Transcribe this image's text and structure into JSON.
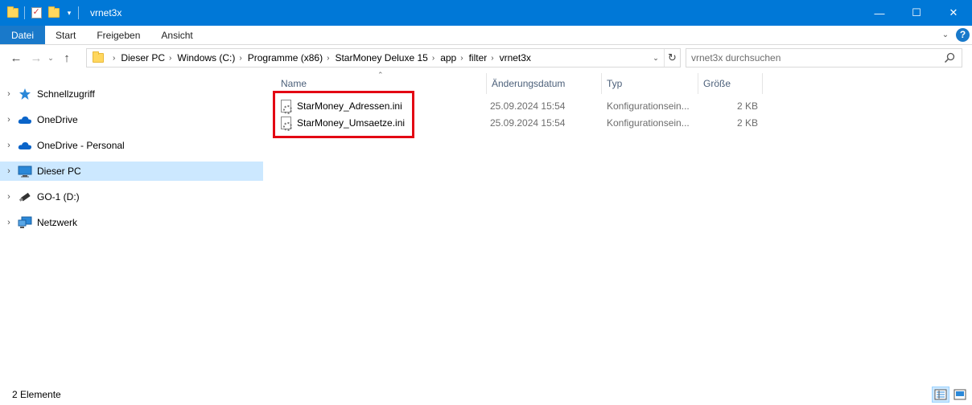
{
  "window": {
    "title": "vrnet3x",
    "minimize_glyph": "—",
    "maximize_glyph": "☐",
    "close_glyph": "✕"
  },
  "ribbon": {
    "tabs": [
      "Datei",
      "Start",
      "Freigeben",
      "Ansicht"
    ],
    "help_label": "?"
  },
  "address": {
    "breadcrumbs": [
      "Dieser PC",
      "Windows (C:)",
      "Programme (x86)",
      "StarMoney Deluxe 15",
      "app",
      "filter",
      "vrnet3x"
    ]
  },
  "search": {
    "placeholder": "vrnet3x durchsuchen"
  },
  "navigation": {
    "items": [
      {
        "label": "Schnellzugriff",
        "icon": "quick-access-star-icon"
      },
      {
        "label": "OneDrive",
        "icon": "onedrive-cloud-icon"
      },
      {
        "label": "OneDrive - Personal",
        "icon": "onedrive-cloud-icon"
      },
      {
        "label": "Dieser PC",
        "icon": "this-pc-monitor-icon"
      },
      {
        "label": "GO-1 (D:)",
        "icon": "usb-drive-icon"
      },
      {
        "label": "Netzwerk",
        "icon": "network-icon"
      }
    ],
    "selected": "Dieser PC"
  },
  "file_list": {
    "columns": [
      "Name",
      "Änderungsdatum",
      "Typ",
      "Größe"
    ],
    "files": [
      {
        "name": "StarMoney_Adressen.ini",
        "modified": "25.09.2024 15:54",
        "type": "Konfigurationsein...",
        "size": "2 KB"
      },
      {
        "name": "StarMoney_Umsaetze.ini",
        "modified": "25.09.2024 15:54",
        "type": "Konfigurationsein...",
        "size": "2 KB"
      }
    ]
  },
  "status": {
    "item_count": "2 Elemente"
  },
  "colors": {
    "titlebar": "#0078d7",
    "file_tab": "#1979ca",
    "selection": "#cce8ff",
    "highlight_box": "#e30613"
  }
}
